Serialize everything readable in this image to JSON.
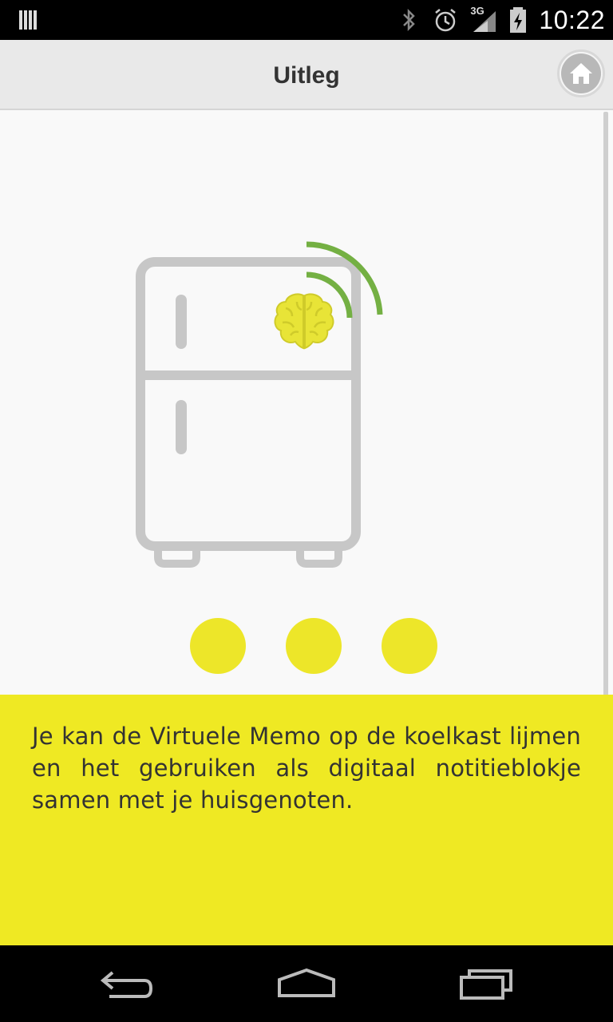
{
  "status_bar": {
    "time": "10:22",
    "network_label": "3G",
    "icons": [
      "notification-bars-icon",
      "bluetooth-icon",
      "alarm-icon",
      "signal-3g-icon",
      "battery-charging-icon"
    ]
  },
  "header": {
    "title": "Uitleg",
    "home_icon": "home-icon"
  },
  "main": {
    "illustration_icon": "fridge-brain-wifi-icon",
    "pager_dots": 3,
    "explanation_text": "Je kan de Virtuele Memo op de koelkast lijmen en het gebruiken als digitaal notitieblokje samen met je huisgenoten."
  },
  "nav_bar": {
    "buttons": [
      "back-icon",
      "home-nav-icon",
      "recent-apps-icon"
    ]
  },
  "colors": {
    "accent_yellow": "#efe923",
    "dot_yellow": "#ede629",
    "brain_yellow": "#e8e437",
    "wifi_green": "#74b043",
    "fridge_gray": "#c7c7c7",
    "header_bg": "#e9e9e9"
  }
}
